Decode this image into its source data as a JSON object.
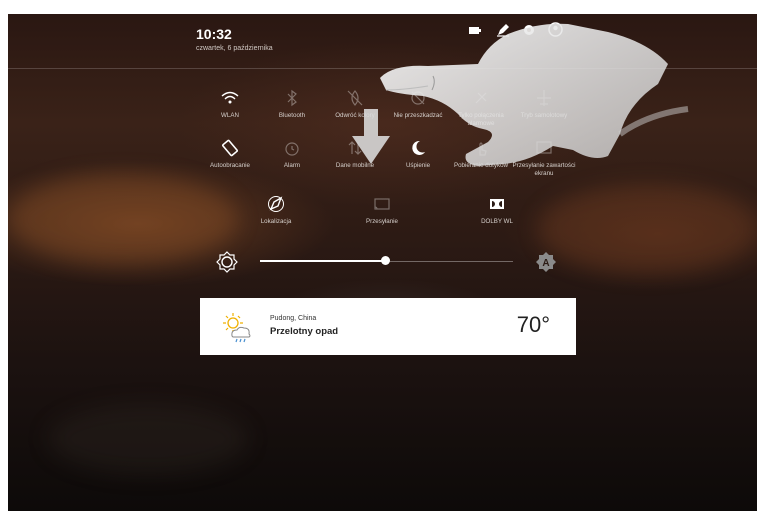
{
  "status_bar": {
    "time": "10:32",
    "date": "czwartek, 6 października",
    "icons": [
      "battery-icon",
      "edit-icon",
      "settings-icon",
      "account-icon"
    ]
  },
  "quick_settings": {
    "row1": [
      {
        "label": "WLAN",
        "icon": "wifi-icon",
        "active": true
      },
      {
        "label": "Bluetooth",
        "icon": "bluetooth-icon",
        "active": false
      },
      {
        "label": "Odwróć kolory",
        "icon": "invert-colors-icon",
        "active": false
      },
      {
        "label": "Nie przeszkadzać",
        "icon": "do-not-disturb-icon",
        "active": false
      },
      {
        "label": "Tylko połączenia alarmowe",
        "icon": "emergency-calls-icon",
        "active": false
      },
      {
        "label": "Tryb samolotowy",
        "icon": "airplane-icon",
        "active": false
      }
    ],
    "row2": [
      {
        "label": "Autoobracanie",
        "icon": "auto-rotate-icon",
        "active": true
      },
      {
        "label": "Alarm",
        "icon": "alarm-icon",
        "active": false
      },
      {
        "label": "Dane mobilne",
        "icon": "mobile-data-icon",
        "active": false
      },
      {
        "label": "Uśpienie",
        "icon": "sleep-icon",
        "active": true
      },
      {
        "label": "Pobieranie dotyków",
        "icon": "touch-icon",
        "active": false
      },
      {
        "label": "Przesyłanie zawartości ekranu",
        "icon": "screen-cast-icon",
        "active": false
      }
    ],
    "row3": [
      {
        "label": "Lokalizacja",
        "icon": "location-icon",
        "active": true
      },
      {
        "label": "Przesyłanie",
        "icon": "cast-icon",
        "active": false
      },
      {
        "label": "DOLBY WL",
        "icon": "dolby-icon",
        "active": true
      }
    ]
  },
  "brightness": {
    "level": 0.5,
    "left_icon": "brightness-icon",
    "right_icon": "auto-brightness-icon"
  },
  "weather": {
    "city": "Pudong, China",
    "condition": "Przelotny opad",
    "temperature": "70°",
    "icon": "partly-sunny-rain-icon"
  },
  "colors": {
    "accent": "#ffffff",
    "card_bg": "#ffffff",
    "text_dim": "#d6d0cc"
  }
}
